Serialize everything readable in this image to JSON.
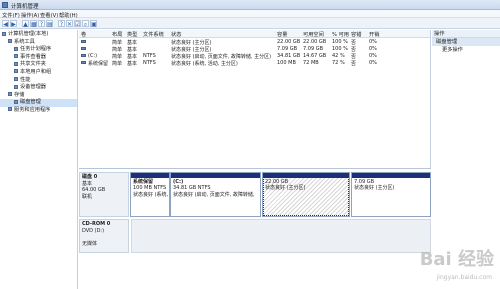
{
  "window": {
    "title": "计算机管理"
  },
  "menu": [
    "文件(F)",
    "操作(A)",
    "查看(V)",
    "帮助(H)"
  ],
  "toolbar_icons": [
    "back-icon",
    "forward-icon",
    "up-icon",
    "show-tree-icon",
    "help-icon",
    "properties-icon",
    "help2-icon",
    "delete-icon",
    "checkbox-icon",
    "search-icon",
    "export-icon"
  ],
  "tree": [
    {
      "label": "计算机管理(本地)",
      "indent": 0
    },
    {
      "label": "系统工具",
      "indent": 1
    },
    {
      "label": "任务计划程序",
      "indent": 2
    },
    {
      "label": "事件查看器",
      "indent": 2
    },
    {
      "label": "共享文件夹",
      "indent": 2
    },
    {
      "label": "本地用户和组",
      "indent": 2
    },
    {
      "label": "性能",
      "indent": 2
    },
    {
      "label": "设备管理器",
      "indent": 2
    },
    {
      "label": "存储",
      "indent": 1
    },
    {
      "label": "磁盘管理",
      "indent": 2,
      "selected": true
    },
    {
      "label": "服务和应用程序",
      "indent": 1
    }
  ],
  "volume_table": {
    "headers": [
      "卷",
      "布局",
      "类型",
      "文件系统",
      "状态",
      "容量",
      "可用空间",
      "% 可用",
      "容错",
      "开销"
    ],
    "rows": [
      [
        "",
        "简单",
        "基本",
        "",
        "状态良好 (主分区)",
        "22.00 GB",
        "22.00 GB",
        "100 %",
        "否",
        "0%"
      ],
      [
        "",
        "简单",
        "基本",
        "",
        "状态良好 (主分区)",
        "7.09 GB",
        "7.09 GB",
        "100 %",
        "否",
        "0%"
      ],
      [
        "(C:)",
        "简单",
        "基本",
        "NTFS",
        "状态良好 (启动, 页面文件, 故障转储, 主分区)",
        "34.81 GB",
        "14.67 GB",
        "42 %",
        "否",
        "0%"
      ],
      [
        "系统保留",
        "简单",
        "基本",
        "NTFS",
        "状态良好 (系统, 活动, 主分区)",
        "100 MB",
        "72 MB",
        "72 %",
        "否",
        "0%"
      ]
    ]
  },
  "disks": [
    {
      "label": [
        "磁盘 0",
        "基本",
        "64.00 GB",
        "联机"
      ],
      "partitions": [
        {
          "lines": [
            "系统保留",
            "100 MB NTFS",
            "状态良好 (系统, 活动, 主"
          ]
        },
        {
          "lines": [
            "(C:)",
            "34.81 GB NTFS",
            "状态良好 (启动, 页面文件, 故障转储,"
          ]
        },
        {
          "lines": [
            "22.00 GB",
            "状态良好 (主分区)"
          ]
        },
        {
          "lines": [
            "7.09 GB",
            "状态良好 (主分区)"
          ]
        }
      ]
    },
    {
      "label": [
        "CD-ROM 0",
        "DVD (D:)",
        "",
        "无媒体"
      ]
    }
  ],
  "actions": {
    "header": "操作",
    "section": "磁盘管理",
    "items": [
      "更多操作"
    ]
  },
  "watermark": {
    "text": "Bai 经验",
    "sub": "jingyan.baidu.com"
  }
}
